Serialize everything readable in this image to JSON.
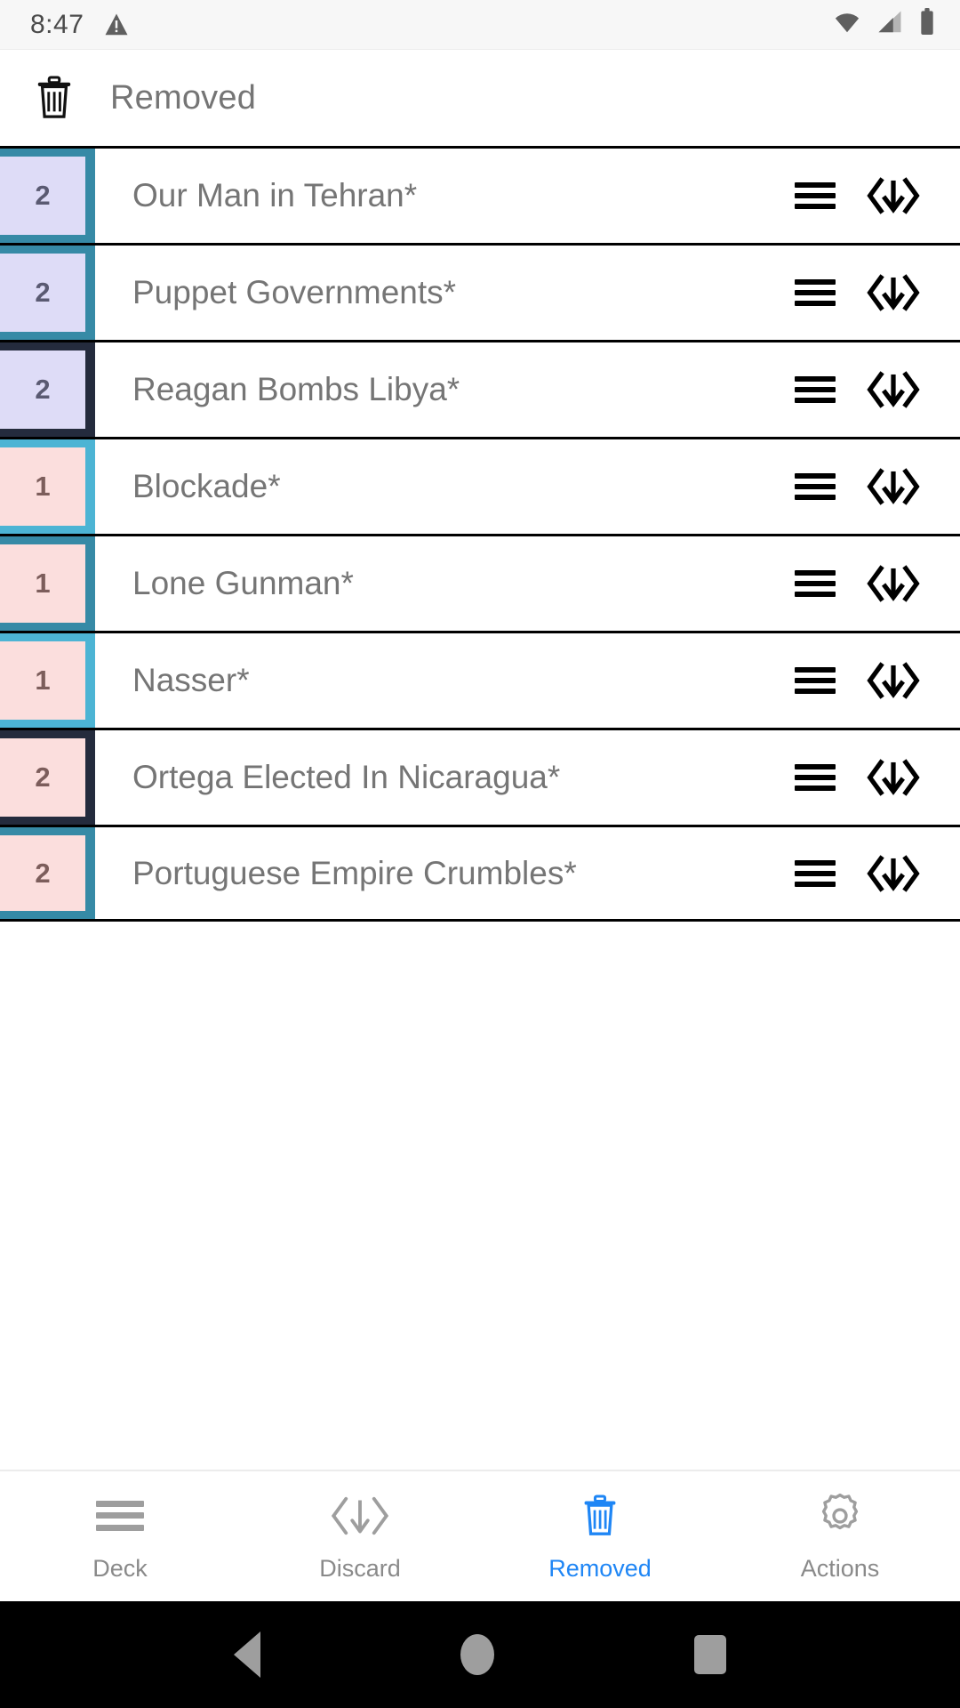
{
  "status_bar": {
    "time": "8:47",
    "icons": [
      "warning-icon",
      "wifi-icon",
      "cellular-signal-icon",
      "battery-icon"
    ]
  },
  "header": {
    "icon": "trash-icon",
    "title": "Removed"
  },
  "list": {
    "rows": [
      {
        "value": "2",
        "title": "Our Man in Tehran*",
        "badge_color": "#dedcf7",
        "frame_color": "#368aa6",
        "badge_class": "badge-lav"
      },
      {
        "value": "2",
        "title": "Puppet Governments*",
        "badge_color": "#dedcf7",
        "frame_color": "#368aa6",
        "badge_class": "badge-lav"
      },
      {
        "value": "2",
        "title": "Reagan Bombs Libya*",
        "badge_color": "#dedcf7",
        "frame_color": "#242b3d",
        "badge_class": "badge-lav"
      },
      {
        "value": "1",
        "title": "Blockade*",
        "badge_color": "#fbdedd",
        "frame_color": "#4cb4d4",
        "badge_class": "badge-pink"
      },
      {
        "value": "1",
        "title": "Lone Gunman*",
        "badge_color": "#fbdedd",
        "frame_color": "#368aa6",
        "badge_class": "badge-pink"
      },
      {
        "value": "1",
        "title": "Nasser*",
        "badge_color": "#fbdedd",
        "frame_color": "#4cb4d4",
        "badge_class": "badge-pink"
      },
      {
        "value": "2",
        "title": "Ortega Elected In Nicaragua*",
        "badge_color": "#fbdedd",
        "frame_color": "#242b3d",
        "badge_class": "badge-pink"
      },
      {
        "value": "2",
        "title": "Portuguese Empire Crumbles*",
        "badge_color": "#fbdedd",
        "frame_color": "#368aa6",
        "badge_class": "badge-pink"
      }
    ],
    "row_action_icons": [
      "hamburger-icon",
      "discard-icon"
    ]
  },
  "bottom_nav": {
    "active_color": "#1f86f5",
    "inactive_color": "#8a8a8a",
    "items": [
      {
        "label": "Deck",
        "icon": "hamburger-icon",
        "active": false
      },
      {
        "label": "Discard",
        "icon": "discard-icon",
        "active": false
      },
      {
        "label": "Removed",
        "icon": "trash-icon",
        "active": true
      },
      {
        "label": "Actions",
        "icon": "gear-icon",
        "active": false
      }
    ]
  },
  "android_nav": {
    "items": [
      "back-button",
      "home-button",
      "recents-button"
    ]
  }
}
